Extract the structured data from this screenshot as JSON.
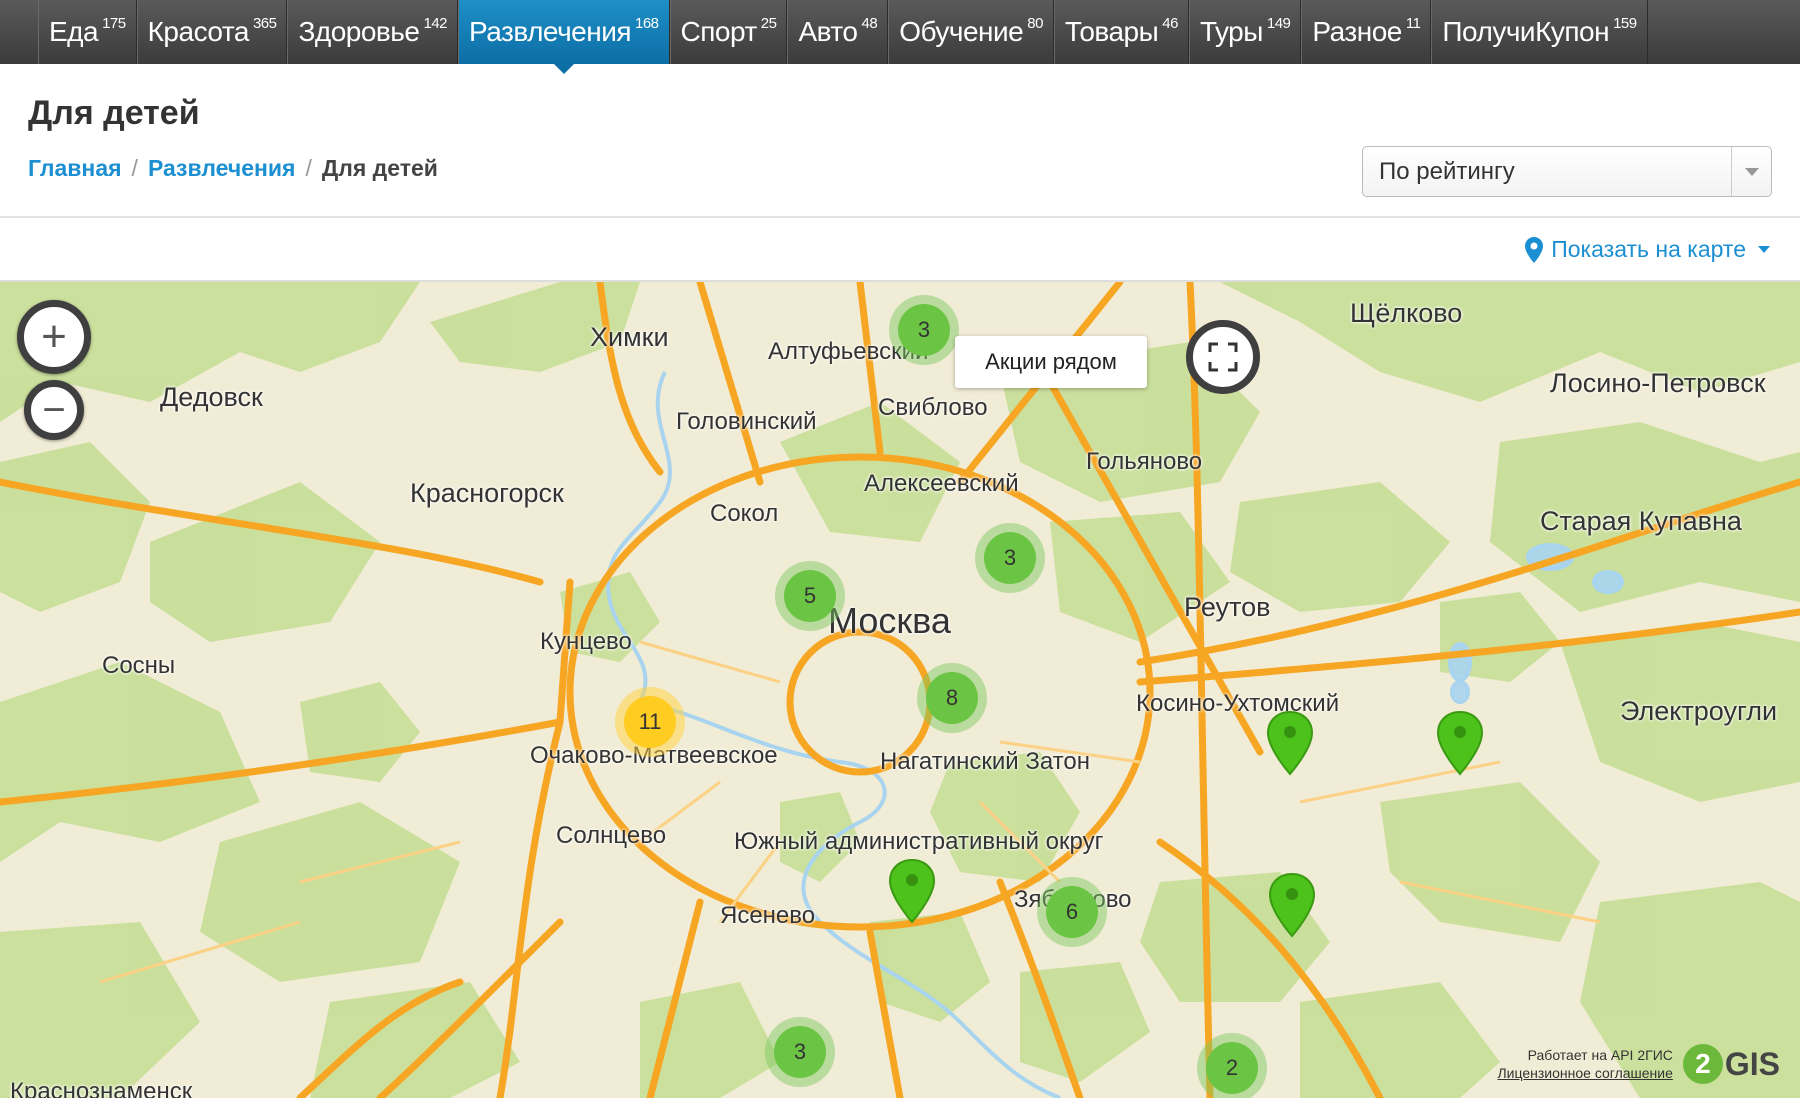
{
  "nav": {
    "items": [
      {
        "label": "Еда",
        "count": "175"
      },
      {
        "label": "Красота",
        "count": "365"
      },
      {
        "label": "Здоровье",
        "count": "142"
      },
      {
        "label": "Развлечения",
        "count": "168",
        "active": true
      },
      {
        "label": "Спорт",
        "count": "25"
      },
      {
        "label": "Авто",
        "count": "48"
      },
      {
        "label": "Обучение",
        "count": "80"
      },
      {
        "label": "Товары",
        "count": "46"
      },
      {
        "label": "Туры",
        "count": "149"
      },
      {
        "label": "Разное",
        "count": "11"
      },
      {
        "label": "ПолучиКупон",
        "count": "159"
      }
    ]
  },
  "page": {
    "title": "Для детей",
    "breadcrumb": {
      "home": "Главная",
      "section": "Развлечения",
      "current": "Для детей",
      "separator": "/"
    }
  },
  "sort": {
    "selected": "По рейтингу"
  },
  "show_map": {
    "label": "Показать на карте"
  },
  "map": {
    "zoom_in": "+",
    "zoom_out": "−",
    "nearby_label": "Акции рядом",
    "cities": {
      "khimki": "Химки",
      "altufyevsky": "Алтуфьевский",
      "shchelkovo": "Щёлково",
      "losino": "Лосино-Петровск",
      "dedovsk": "Дедовск",
      "golovinsky": "Головинский",
      "sviblovo": "Свиблово",
      "golyanovo": "Гольяново",
      "krasnogorsk": "Красногорск",
      "alekseevsky": "Алексеевский",
      "sokol": "Сокол",
      "staraya_kupavna": "Старая Купавна",
      "moskva": "Москва",
      "reutov": "Реутов",
      "kuntsevo": "Кунцево",
      "sosny": "Сосны",
      "kosino": "Косино-Ухтомский",
      "elektrougli": "Электроугли",
      "ochakovo": "Очаково-Матвеевское",
      "nagatinsky": "Нагатинский Затон",
      "solntsevo": "Солнцево",
      "yuzhny": "Южный административный округ",
      "zyablikovo": "Зябликово",
      "yasenevo": "Ясенево",
      "krasnoznamensk": "Краснознаменск"
    },
    "clusters": {
      "c1": "3",
      "c2": "3",
      "c3": "5",
      "c4": "8",
      "c5": "11",
      "c6": "6",
      "c7": "3",
      "c8": "2"
    },
    "attribution": {
      "line1": "Работает на API 2ГИС",
      "line2": "Лицензионное соглашение",
      "logo_digit": "2",
      "logo_text": "GIS"
    }
  },
  "colors": {
    "accent": "#1b8fd2",
    "nav_active": "#0d6ea5",
    "cluster_green": "#6cc444",
    "cluster_yellow": "#ffcc22",
    "road": "#f6a623"
  }
}
